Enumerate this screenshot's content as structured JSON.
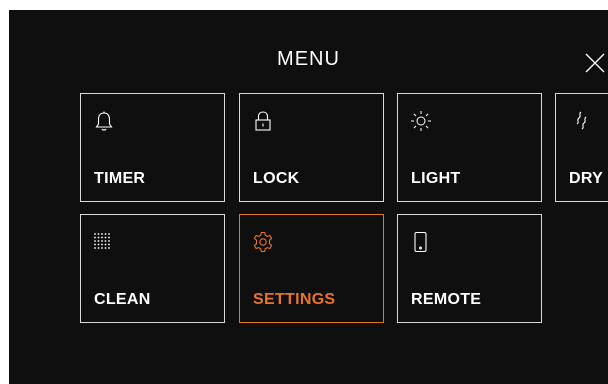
{
  "header": {
    "title": "MENU",
    "close_icon": "close-icon"
  },
  "menu": {
    "items": [
      {
        "label": "TIMER",
        "icon": "bell-icon",
        "active": false
      },
      {
        "label": "LOCK",
        "icon": "lock-icon",
        "active": false
      },
      {
        "label": "LIGHT",
        "icon": "sun-icon",
        "active": false
      },
      {
        "label": "DRY",
        "icon": "dry-waves-icon",
        "active": false
      },
      {
        "label": "CLEAN",
        "icon": "dot-grid-icon",
        "active": false
      },
      {
        "label": "SETTINGS",
        "icon": "gear-icon",
        "active": true
      },
      {
        "label": "REMOTE",
        "icon": "phone-icon",
        "active": false
      }
    ]
  },
  "colors": {
    "background": "#0f0f0f",
    "text": "#ffffff",
    "tile_border": "#d8d8d8",
    "accent": "#e8732b"
  }
}
